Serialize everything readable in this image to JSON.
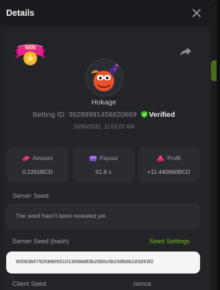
{
  "header": {
    "title": "Details"
  },
  "badge": {
    "text": "WIN"
  },
  "player": {
    "username": "Hokage",
    "betting_id_label": "Betting ID:",
    "betting_id": "3928999145662066​9",
    "verified_label": "Verified",
    "timestamp": "10/30/2021, 11:53:07 AM"
  },
  "stats": {
    "amount": {
      "label": "Amount",
      "value": "0.2261BCD"
    },
    "payout": {
      "label": "Payout",
      "value": "51.6 x"
    },
    "profit": {
      "label": "Profit",
      "value": "+11.440660BCD"
    }
  },
  "server_seed": {
    "label": "Server Seed",
    "message": "The seed hasn't been revealed yet."
  },
  "server_seed_hash": {
    "label": "Server Seed (hash)",
    "settings_link": "Seed Settings",
    "value": "90063b57925886551013068d80b26b5c6b168b6b183263f2"
  },
  "client_seed": {
    "label": "Client Seed",
    "nonce_label": "nonce"
  },
  "colors": {
    "accent_green": "#6fbf1a",
    "verified_green": "#3bc117"
  }
}
